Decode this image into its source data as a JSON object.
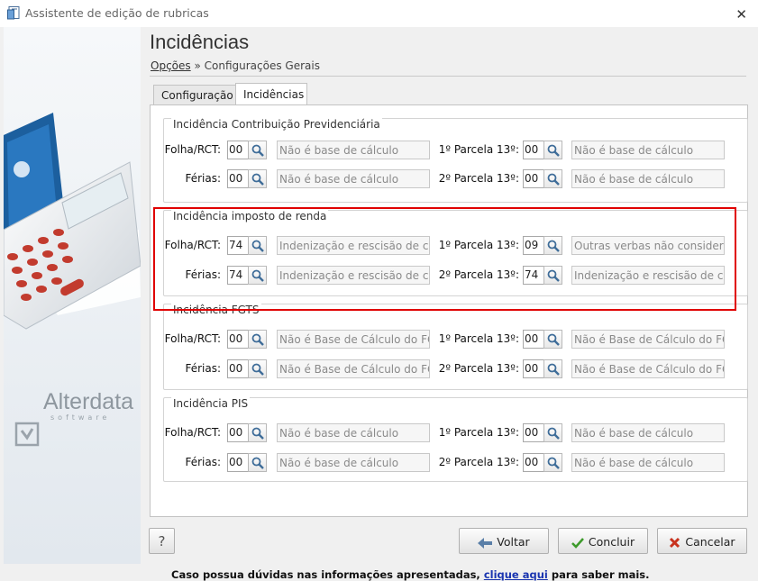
{
  "window": {
    "title": "Assistente de edição de rubricas"
  },
  "brand": {
    "name": "Alterdata",
    "tagline": "software"
  },
  "header": {
    "title": "Incidências",
    "breadcrumb_link": "Opções",
    "breadcrumb_sep": "»",
    "breadcrumb_current": "Configurações Gerais"
  },
  "tabs": [
    {
      "label": "Configuração"
    },
    {
      "label": "Incidências"
    }
  ],
  "groups": [
    {
      "legend": "Incidência Contribuição Previdenciária",
      "rows": [
        {
          "left": {
            "label": "Folha/RCT:",
            "code": "00",
            "desc": "Não é base de cálculo"
          },
          "right": {
            "label": "1º Parcela 13º:",
            "code": "00",
            "desc": "Não é base de cálculo"
          }
        },
        {
          "left": {
            "label": "Férias:",
            "code": "00",
            "desc": "Não é base de cálculo"
          },
          "right": {
            "label": "2º Parcela 13º:",
            "code": "00",
            "desc": "Não é base de cálculo"
          }
        }
      ]
    },
    {
      "legend": "Incidência imposto de renda",
      "rows": [
        {
          "left": {
            "label": "Folha/RCT:",
            "code": "74",
            "desc": "Indenização e rescisão de contra"
          },
          "right": {
            "label": "1º Parcela 13º:",
            "code": "09",
            "desc": "Outras verbas não consideradas"
          }
        },
        {
          "left": {
            "label": "Férias:",
            "code": "74",
            "desc": "Indenização e rescisão de contra"
          },
          "right": {
            "label": "2º Parcela 13º:",
            "code": "74",
            "desc": "Indenização e rescisão de contra"
          }
        }
      ]
    },
    {
      "legend": "Incidência FGTS",
      "rows": [
        {
          "left": {
            "label": "Folha/RCT:",
            "code": "00",
            "desc": "Não é Base de Cálculo do FGTS"
          },
          "right": {
            "label": "1º Parcela 13º:",
            "code": "00",
            "desc": "Não é Base de Cálculo do FGTS"
          }
        },
        {
          "left": {
            "label": "Férias:",
            "code": "00",
            "desc": "Não é Base de Cálculo do FGTS"
          },
          "right": {
            "label": "2º Parcela 13º:",
            "code": "00",
            "desc": "Não é Base de Cálculo do FGTS"
          }
        }
      ]
    },
    {
      "legend": "Incidência PIS",
      "rows": [
        {
          "left": {
            "label": "Folha/RCT:",
            "code": "00",
            "desc": "Não é base de cálculo"
          },
          "right": {
            "label": "1º Parcela 13º:",
            "code": "00",
            "desc": "Não é base de cálculo"
          }
        },
        {
          "left": {
            "label": "Férias:",
            "code": "00",
            "desc": "Não é base de cálculo"
          },
          "right": {
            "label": "2º Parcela 13º:",
            "code": "00",
            "desc": "Não é base de cálculo"
          }
        }
      ]
    }
  ],
  "info": {
    "text": "Caso possua dúvidas nas informações apresentadas,",
    "link": "clique aqui",
    "suffix": "para saber mais."
  },
  "buttons": {
    "help": "?",
    "back": "Voltar",
    "finish": "Concluir",
    "cancel": "Cancelar"
  },
  "icons": {
    "app": "form-icon",
    "search": "magnifier-icon",
    "back": "arrow-left-icon",
    "finish": "check-icon",
    "cancel": "x-icon"
  },
  "colors": {
    "highlight": "#e00000",
    "link": "#1a35b0",
    "check": "#3c9a2a",
    "cancel": "#c8321e",
    "back": "#5a7fa8"
  }
}
